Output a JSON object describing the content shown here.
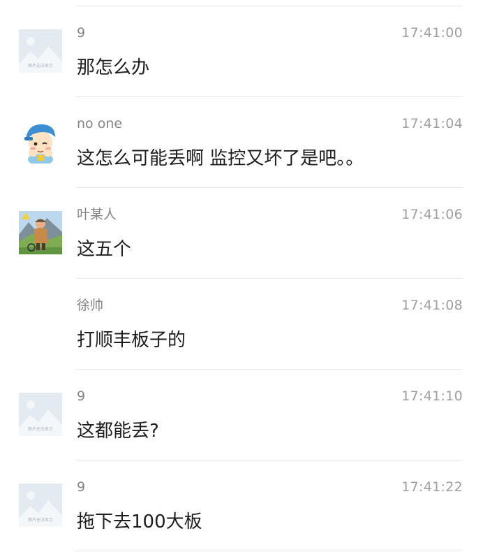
{
  "messages": [
    {
      "avatar": "placeholder-image-icon",
      "placeholder_caption": "图片无法显示",
      "name": "9",
      "time": "17:41:00",
      "text": "那怎么办"
    },
    {
      "avatar": "cartoon-boy-avatar",
      "name": "no one",
      "time": "17:41:04",
      "text": "这怎么可能丢啊 监控又坏了是吧。。"
    },
    {
      "avatar": "cyclist-avatar",
      "name": "叶某人",
      "time": "17:41:06",
      "text": "这五个"
    },
    {
      "avatar": "none",
      "name": "徐帅",
      "time": "17:41:08",
      "text": "打顺丰板子的"
    },
    {
      "avatar": "placeholder-image-icon",
      "placeholder_caption": "图片无法显示",
      "name": "9",
      "time": "17:41:10",
      "text": "这都能丢?"
    },
    {
      "avatar": "placeholder-image-icon",
      "placeholder_caption": "图片无法显示",
      "name": "9",
      "time": "17:41:22",
      "text": "拖下去100大板"
    }
  ]
}
